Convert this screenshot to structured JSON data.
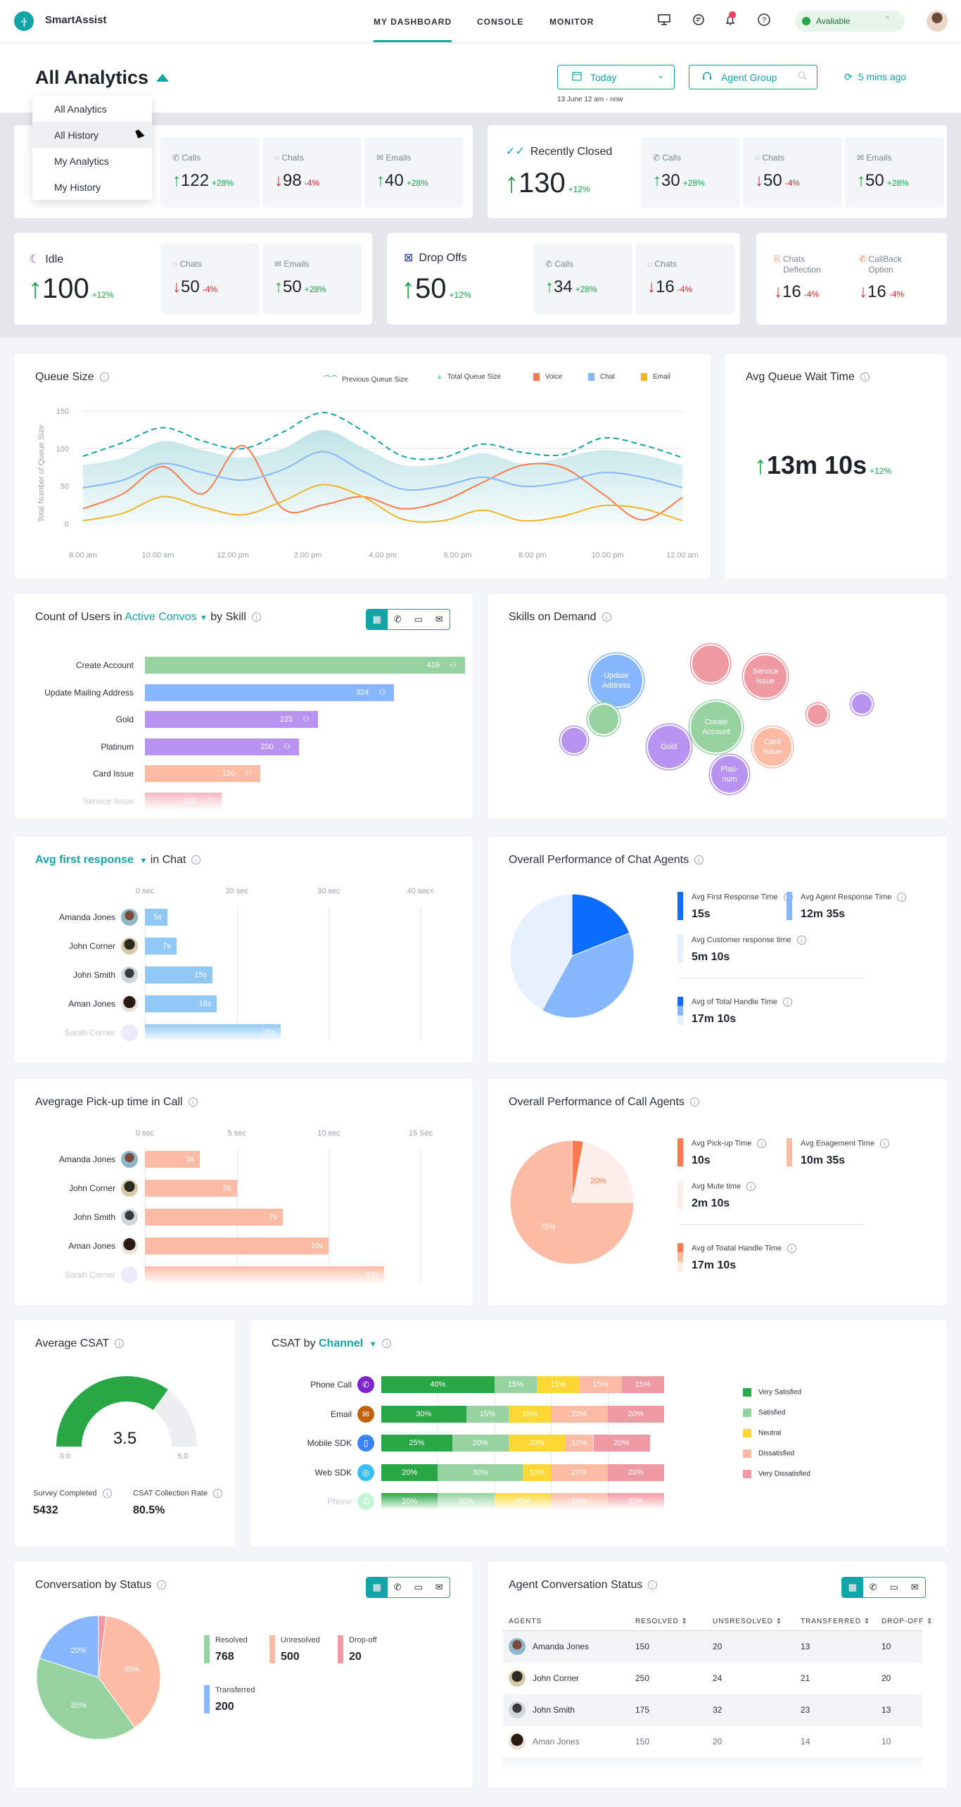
{
  "app": {
    "name": "SmartAssist",
    "logo_glyph": "·|·"
  },
  "nav": {
    "items": [
      {
        "label": "MY DASHBOARD",
        "active": true
      },
      {
        "label": "CONSOLE"
      },
      {
        "label": "MONITOR"
      }
    ]
  },
  "topbar": {
    "icons": [
      "monitor-icon",
      "chat-bubble-icon",
      "bell-icon",
      "help-icon"
    ],
    "status_label": "Avaliable",
    "status_color": "#28a745",
    "notification_color": "#f43f5e"
  },
  "header": {
    "title": "All Analytics",
    "menu": [
      "All Analytics",
      "All History",
      "My Analytics",
      "My History"
    ],
    "menu_hover": "All History",
    "date_filter": "Today",
    "date_range": "13 June  12 am - now",
    "agent_group": "Agent Group",
    "refresh": "5 mins ago"
  },
  "kpis": {
    "row1_left": {
      "subs": [
        {
          "label": "Calls",
          "value": "122",
          "delta": "+28%",
          "dir": "up"
        },
        {
          "label": "Chats",
          "value": "98",
          "delta": "-4%",
          "dir": "down"
        },
        {
          "label": "Emails",
          "value": "40",
          "delta": "+28%",
          "dir": "up"
        }
      ]
    },
    "recently_closed": {
      "label": "Recently Closed",
      "value": "130",
      "delta": "+12%",
      "subs": [
        {
          "label": "Calls",
          "value": "30",
          "delta": "+28%"
        },
        {
          "label": "Chats",
          "value": "50",
          "delta": "-4%"
        },
        {
          "label": "Emails",
          "value": "50",
          "delta": "+28%"
        }
      ]
    },
    "idle": {
      "label": "Idle",
      "value": "100",
      "delta": "+12%",
      "subs": [
        {
          "label": "Chats",
          "value": "50",
          "delta": "-4%"
        },
        {
          "label": "Emails",
          "value": "50",
          "delta": "+28%"
        }
      ]
    },
    "drop_offs": {
      "label": "Drop Offs",
      "value": "50",
      "delta": "+12%",
      "subs": [
        {
          "label": "Calls",
          "value": "34",
          "delta": "+28%"
        },
        {
          "label": "Chats",
          "value": "16",
          "delta": "-4%"
        }
      ]
    },
    "deflection": [
      {
        "label1": "Chats",
        "label2": "Deflection",
        "value": "16",
        "delta": "-4%"
      },
      {
        "label1": "CallBack",
        "label2": "Option",
        "value": "16",
        "delta": "-4%"
      }
    ]
  },
  "queue_size": {
    "title": "Queue Size",
    "legend": [
      "Previous Queue Size",
      "Total Queue Size",
      "Voice",
      "Chat",
      "Email"
    ]
  },
  "avg_queue_wait": {
    "title": "Avg Queue Wait Time",
    "value": "13m 10s",
    "delta": "+12%"
  },
  "active_convos": {
    "title_pre": "Count of Users in",
    "title_link": "Active Convos",
    "title_post": "by Skill"
  },
  "skills_on_demand": {
    "title": "Skills on Demand",
    "bubbles": [
      {
        "label": "Update Address",
        "color": "#86b7fc"
      },
      {
        "label": "",
        "color": "#ef9aa2"
      },
      {
        "label": "Service Issue",
        "color": "#ef9aa2"
      },
      {
        "label": "",
        "color": "#96d3a1"
      },
      {
        "label": "Create Account",
        "color": "#96d3a1"
      },
      {
        "label": "",
        "color": "#ef9aa2"
      },
      {
        "label": "",
        "color": "#b794f0"
      },
      {
        "label": "",
        "color": "#b794f0"
      },
      {
        "label": "Gold",
        "color": "#b794f0"
      },
      {
        "label": "Card Issue",
        "color": "#fcbba4"
      },
      {
        "label": "Plati-num",
        "color": "#b794f0"
      }
    ]
  },
  "first_response": {
    "title_link": "Avg first response",
    "title_post": "in Chat"
  },
  "pickup": {
    "title": "Avegrage Pick-up time in Call"
  },
  "chat_perf": {
    "title": "Overall Performance of Chat Agents",
    "metrics": [
      {
        "label": "Avg First Response Time",
        "value": "15s",
        "color": "#0d6efd"
      },
      {
        "label": "Avg Agent Response Time",
        "value": "12m 35s",
        "color": "#86b7fc"
      },
      {
        "label": "Avg Customer response time",
        "value": "5m 10s",
        "color": "#e6f0fe"
      }
    ],
    "total": {
      "label": "Avg of Total Handle Time",
      "value": "17m 10s"
    }
  },
  "call_perf": {
    "title": "Overall Performance of Call Agents",
    "metrics": [
      {
        "label": "Avg Pick-up Time",
        "value": "10s",
        "color": "#fd7a4e"
      },
      {
        "label": "Avg Enagement Time",
        "value": "10m 35s",
        "color": "#fcbba4"
      },
      {
        "label": "Avg Mute time",
        "value": "2m 10s",
        "color": "#fdeeea"
      }
    ],
    "total": {
      "label": "Avg of Toatal Handle Time",
      "value": "17m 10s"
    }
  },
  "csat": {
    "title": "Average CSAT",
    "value": "3.5",
    "min": "0.0",
    "max": "5.0",
    "fraction": 0.7,
    "survey_label": "Survey Completed",
    "survey_value": "5432",
    "rate_label": "CSAT Collection Rate",
    "rate_value": "80.5%"
  },
  "csat_channel": {
    "title_pre": "CSAT by",
    "title_link": "Channel"
  },
  "conv_status": {
    "title": "Conversation by Status",
    "metrics": [
      {
        "label": "Resolved",
        "value": "768",
        "color": "#96d3a1"
      },
      {
        "label": "Unresolved",
        "value": "500",
        "color": "#fcbba4"
      },
      {
        "label": "Drop-off",
        "value": "20",
        "color": "#ef9aa2"
      },
      {
        "label": "Transferred",
        "value": "200",
        "color": "#86b7fc"
      }
    ]
  },
  "agent_status": {
    "title": "Agent Conversation Status",
    "columns": [
      "AGENTS",
      "RESOLVED",
      "UNSRESOLVED",
      "TRANSFERRED",
      "DROP-OFF"
    ],
    "rows": [
      [
        "Amanda Jones",
        "150",
        "20",
        "13",
        "10"
      ],
      [
        "John Corner",
        "250",
        "24",
        "21",
        "20"
      ],
      [
        "John Smith",
        "175",
        "32",
        "23",
        "13"
      ],
      [
        "Aman Jones",
        "150",
        "20",
        "14",
        "10"
      ]
    ]
  },
  "chart_data": [
    {
      "type": "line",
      "title": "Queue Size",
      "ylabel": "Total Number of Queue Size",
      "xlabel": "",
      "x": [
        "8.00 am",
        "10.00 am",
        "12.00 pm",
        "2.00 pm",
        "4.00 pm",
        "6.00 pm",
        "8.00 pm",
        "10.00 pm",
        "12.00 am"
      ],
      "ylim": [
        0,
        150
      ],
      "yticks": [
        0,
        50,
        100,
        150
      ],
      "grid": true,
      "legend": "top-right",
      "series": [
        {
          "name": "Previous Queue Size",
          "style": "dashed",
          "color": "#13a4a8",
          "values": [
            90,
            108,
            128,
            110,
            100,
            122,
            148,
            124,
            90,
            88,
            106,
            95,
            92,
            114,
            105,
            88
          ]
        },
        {
          "name": "Total Queue Size",
          "style": "area",
          "color": "#c9e8ea",
          "values": [
            78,
            88,
            110,
            98,
            88,
            100,
            125,
            102,
            78,
            80,
            94,
            80,
            88,
            98,
            92,
            78
          ]
        },
        {
          "name": "Voice",
          "color": "#fd7a4e",
          "values": [
            20,
            40,
            76,
            40,
            104,
            20,
            25,
            36,
            20,
            30,
            55,
            78,
            75,
            40,
            5,
            35
          ]
        },
        {
          "name": "Chat",
          "color": "#86b7fc",
          "values": [
            48,
            58,
            80,
            68,
            58,
            72,
            96,
            70,
            46,
            50,
            62,
            50,
            55,
            68,
            62,
            48
          ]
        },
        {
          "name": "Email",
          "color": "#f0b429",
          "values": [
            4,
            14,
            36,
            22,
            12,
            30,
            52,
            36,
            6,
            4,
            18,
            4,
            10,
            24,
            20,
            4
          ]
        }
      ]
    },
    {
      "type": "bar",
      "orientation": "horizontal",
      "title": "Count of Users in Active Convos by Skill",
      "categories": [
        "Create Account",
        "Update Mailing Address",
        "Gold",
        "Platinum",
        "Card Issue",
        "Service Issue"
      ],
      "values": [
        416,
        324,
        225,
        200,
        150,
        100
      ],
      "colors": [
        "#96d3a1",
        "#86b7fc",
        "#b794f0",
        "#b794f0",
        "#fcbba4",
        "#f4b7bf"
      ],
      "xlim": [
        0,
        416
      ]
    },
    {
      "type": "bar",
      "orientation": "horizontal",
      "title": "Avg first response in Chat",
      "categories": [
        "Amanda Jones",
        "John Corner",
        "John Smith",
        "Aman Jones",
        "Sarah Corner"
      ],
      "values": [
        5,
        7,
        15,
        16,
        25
      ],
      "labels": [
        "5s",
        "7s",
        "15s",
        "16s",
        "25s"
      ],
      "xticks": [
        "0 sec",
        "20 sec",
        "30 sec",
        "40 sec<"
      ],
      "color": "#90c8f7"
    },
    {
      "type": "bar",
      "orientation": "horizontal",
      "title": "Avegrage Pick-up time in Call",
      "categories": [
        "Amanda Jones",
        "John Corner",
        "John Smith",
        "Aman Jones",
        "Sarah Corner"
      ],
      "values": [
        3,
        5,
        7.5,
        10,
        13
      ],
      "labels": [
        "3s",
        "5s",
        "7s",
        "10s",
        "13s"
      ],
      "xticks": [
        "0 sec",
        "5 sec",
        "10 sec",
        "15 Sec"
      ],
      "xlim": [
        0,
        15
      ],
      "color": "#fcbba4"
    },
    {
      "type": "pie",
      "title": "Overall Performance of Chat Agents",
      "categories": [
        "Avg First Response Time",
        "Avg Agent Response Time",
        "Avg Customer response time"
      ],
      "values": [
        19,
        39,
        42
      ],
      "colors": [
        "#0d6efd",
        "#86b7fc",
        "#e6f0fe"
      ]
    },
    {
      "type": "pie",
      "title": "Overall Performance of Call Agents",
      "categories": [
        "Avg Pick-up Time",
        "Avg Mute time",
        "Avg Enagement Time"
      ],
      "values": [
        3,
        22,
        75
      ],
      "labels": [
        "",
        "20%",
        "75%"
      ],
      "colors": [
        "#fd7a4e",
        "#fdeeea",
        "#fcbba4"
      ]
    },
    {
      "type": "bar",
      "orientation": "horizontal",
      "stacked": true,
      "title": "CSAT by Channel",
      "categories": [
        "Phone Call",
        "Email",
        "Mobile SDK",
        "Web SDK",
        "Phone"
      ],
      "legend": "right",
      "series": [
        {
          "name": "Very Satisfied",
          "color": "#28a745",
          "values": [
            40,
            30,
            25,
            20,
            20
          ]
        },
        {
          "name": "Satisfied",
          "color": "#96d3a1",
          "values": [
            15,
            15,
            20,
            30,
            20
          ]
        },
        {
          "name": "Neutral",
          "color": "#fdd835",
          "values": [
            15,
            15,
            20,
            10,
            20
          ]
        },
        {
          "name": "Dissatisfied",
          "color": "#fcbba4",
          "values": [
            15,
            20,
            10,
            20,
            20
          ]
        },
        {
          "name": "Very Dissatisfied",
          "color": "#ef9aa2",
          "values": [
            15,
            20,
            20,
            20,
            20
          ]
        }
      ]
    },
    {
      "type": "pie",
      "title": "Conversation by Status",
      "categories": [
        "Drop-off",
        "Unresolved",
        "Resolved",
        "Transferred"
      ],
      "values": [
        2,
        38,
        40,
        20
      ],
      "labels": [
        "",
        "35%",
        "35%",
        "20%"
      ],
      "colors": [
        "#ef9aa2",
        "#fcbba4",
        "#96d3a1",
        "#86b7fc"
      ]
    }
  ]
}
